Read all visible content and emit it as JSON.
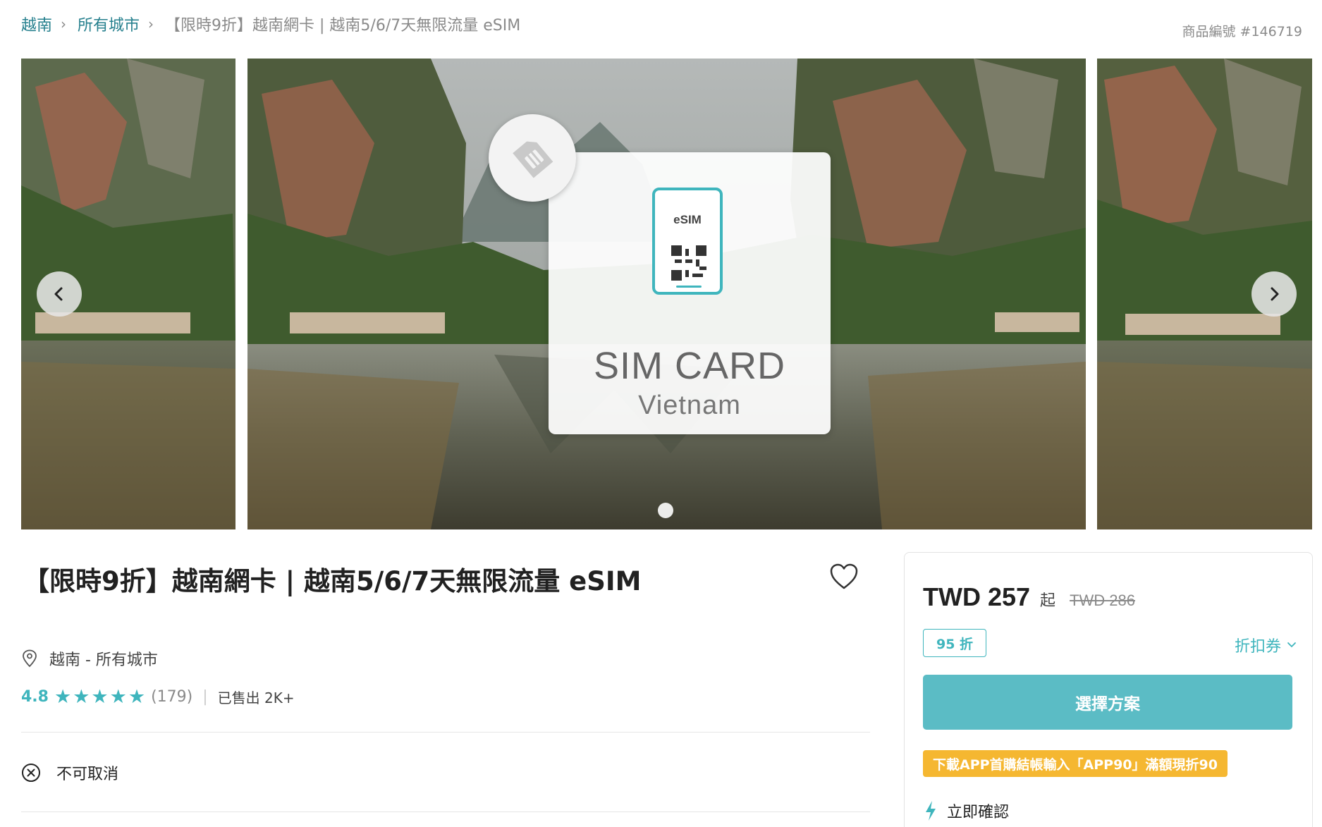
{
  "breadcrumb": {
    "items": [
      "越南",
      "所有城市"
    ],
    "current": "【限時9折】越南網卡 | 越南5/6/7天無限流量 eSIM"
  },
  "product_id": "商品編號 #146719",
  "gallery": {
    "sim_badge_icon": "sim-card-icon",
    "phone_label": "eSIM",
    "card_title": "SIM CARD",
    "card_subtitle": "Vietnam"
  },
  "product": {
    "title": "【限時9折】越南網卡 | 越南5/6/7天無限流量 eSIM",
    "location": "越南 - 所有城市",
    "rating": "4.8",
    "stars": 5,
    "review_count": "(179)",
    "sold": "已售出 2K+",
    "policy": "不可取消"
  },
  "panel": {
    "price": "TWD 257",
    "price_suffix": "起",
    "original_price": "TWD 286",
    "discount": "95 折",
    "coupon": "折扣券",
    "select_button": "選擇方案",
    "promo": "下載APP首購結帳輸入「APP90」滿額現折90",
    "instant": "立即確認"
  },
  "colors": {
    "accent": "#3fb5bd",
    "button": "#5bbcc5",
    "link": "#26808e",
    "promo": "#f5b731"
  }
}
